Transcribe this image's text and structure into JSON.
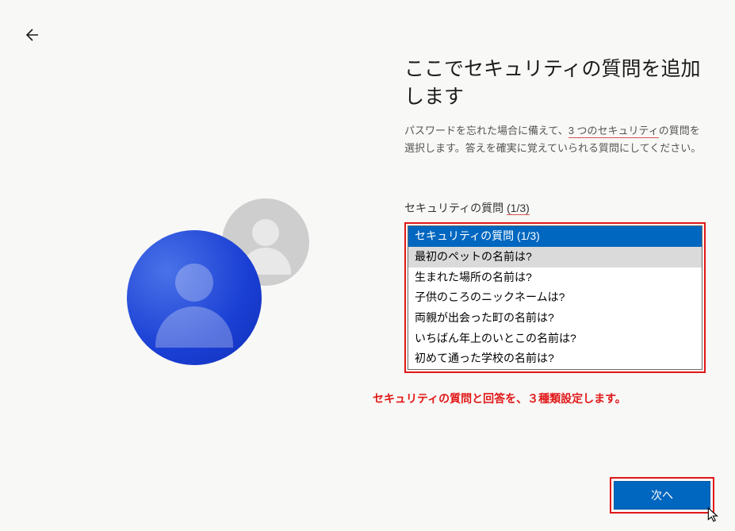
{
  "title": "ここでセキュリティの質問を追加します",
  "description_before": "パスワードを忘れた場合に備えて、",
  "description_underlined": "3 つのセキュリティ",
  "description_after": "の質問を選択します。答えを確実に覚えていられる質問にしてください。",
  "question_label": "セキュリティの質問 ",
  "question_fraction": "(1/3)",
  "dropdown": {
    "options": [
      "セキュリティの質問 (1/3)",
      "最初のペットの名前は?",
      "生まれた場所の名前は?",
      "子供のころのニックネームは?",
      "両親が出会った町の名前は?",
      "いちばん年上のいとこの名前は?",
      "初めて通った学校の名前は?"
    ]
  },
  "annotation": "セキュリティの質問と回答を、３種類設定します。",
  "next_button": "次へ"
}
